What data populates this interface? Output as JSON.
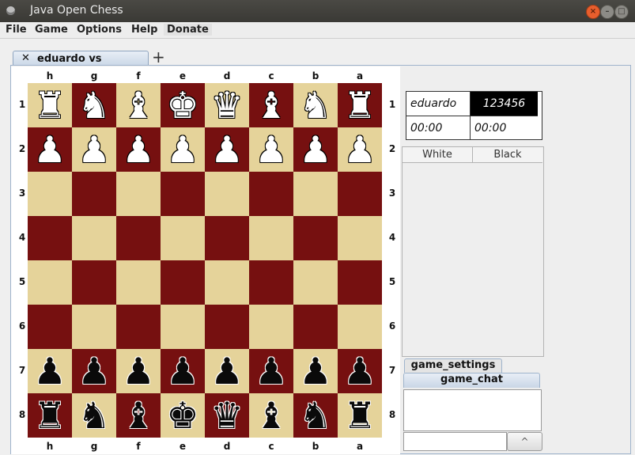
{
  "window": {
    "title": "Java Open Chess",
    "close_glyph": "×",
    "min_glyph": "–",
    "max_glyph": "□"
  },
  "menu": [
    "File",
    "Game",
    "Options",
    "Help",
    "Donate"
  ],
  "tab": {
    "close_glyph": "✕",
    "label": "eduardo vs 123456",
    "new_tab_glyph": "+"
  },
  "board": {
    "files": [
      "h",
      "g",
      "f",
      "e",
      "d",
      "c",
      "b",
      "a"
    ],
    "ranks": [
      "1",
      "2",
      "3",
      "4",
      "5",
      "6",
      "7",
      "8"
    ],
    "light_color": "#e5d39a",
    "dark_color": "#761010",
    "squares": [
      [
        "w-rook",
        "w-knight",
        "w-bishop",
        "w-king",
        "w-queen",
        "w-bishop",
        "w-knight",
        "w-rook"
      ],
      [
        "w-pawn",
        "w-pawn",
        "w-pawn",
        "w-pawn",
        "w-pawn",
        "w-pawn",
        "w-pawn",
        "w-pawn"
      ],
      [
        "",
        "",
        "",
        "",
        "",
        "",
        "",
        ""
      ],
      [
        "",
        "",
        "",
        "",
        "",
        "",
        "",
        ""
      ],
      [
        "",
        "",
        "",
        "",
        "",
        "",
        "",
        ""
      ],
      [
        "",
        "",
        "",
        "",
        "",
        "",
        "",
        ""
      ],
      [
        "b-pawn",
        "b-pawn",
        "b-pawn",
        "b-pawn",
        "b-pawn",
        "b-pawn",
        "b-pawn",
        "b-pawn"
      ],
      [
        "b-rook",
        "b-knight",
        "b-bishop",
        "b-king",
        "b-queen",
        "b-bishop",
        "b-knight",
        "b-rook"
      ]
    ]
  },
  "players": {
    "white_name": "eduardo",
    "black_name": "123456",
    "white_time": "00:00",
    "black_time": "00:00"
  },
  "moves_table": {
    "headers": [
      "White",
      "Black"
    ]
  },
  "side_tabs": {
    "settings": "game_settings",
    "chat": "game_chat"
  },
  "chat": {
    "send_glyph": "^"
  }
}
